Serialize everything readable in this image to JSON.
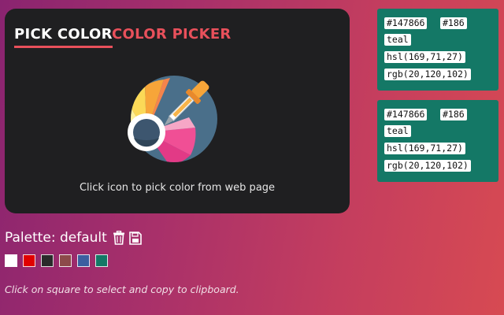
{
  "tabs": {
    "pick_label": "PICK COLOR",
    "picker_label": "COLOR PICKER"
  },
  "pick": {
    "caption": "Click icon to pick color from web page"
  },
  "cards": [
    {
      "hex": "#147866",
      "short": "#186",
      "name": "teal",
      "hsl": "hsl(169,71,27)",
      "rgb": "rgb(20,120,102)",
      "color": "#147866"
    },
    {
      "hex": "#147866",
      "short": "#186",
      "name": "teal",
      "hsl": "hsl(169,71,27)",
      "rgb": "rgb(20,120,102)",
      "color": "#147866"
    }
  ],
  "palette": {
    "title": "Palette: default",
    "delete_icon": "trash-icon",
    "save_icon": "floppy-disk-icon",
    "swatches": [
      "#ffffff",
      "#e00000",
      "#2a2a2a",
      "#8c4a4a",
      "#3b5fa0",
      "#147866"
    ]
  },
  "hint": "Click on square to select and copy to clipboard.",
  "colors": {
    "accent": "#e8505b",
    "panel": "#1f1f21",
    "card": "#147866"
  }
}
